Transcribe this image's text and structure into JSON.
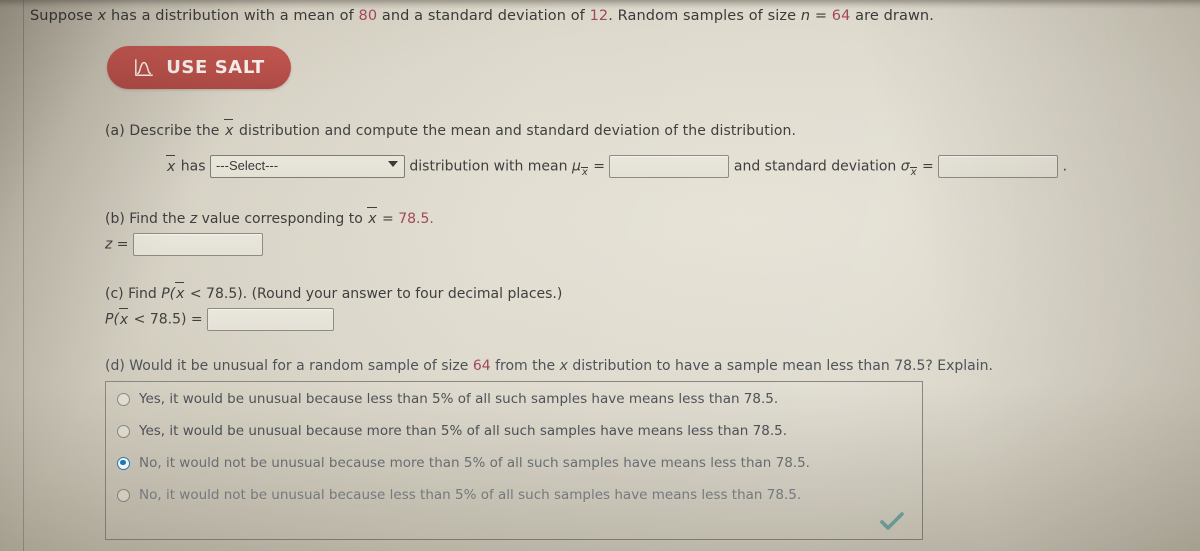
{
  "problem": {
    "statement_parts": [
      {
        "t": "Suppose ",
        "k": "plain"
      },
      {
        "t": "x",
        "k": "ital"
      },
      {
        "t": " has a distribution with a mean of ",
        "k": "plain"
      },
      {
        "t": "80",
        "k": "num"
      },
      {
        "t": " and a standard deviation of ",
        "k": "plain"
      },
      {
        "t": "12",
        "k": "num"
      },
      {
        "t": ". Random samples of size ",
        "k": "plain"
      },
      {
        "t": "n",
        "k": "ital"
      },
      {
        "t": " = ",
        "k": "plain"
      },
      {
        "t": "64",
        "k": "num"
      },
      {
        "t": " are drawn.",
        "k": "plain"
      }
    ],
    "mean": "80",
    "std_dev": "12",
    "sample_size": "64",
    "x_bar_value": "78.5"
  },
  "salt_button": {
    "label": "USE SALT",
    "icon": "normal-curve-icon",
    "color": "#b8504a"
  },
  "part_a": {
    "label": "(a) Describe the",
    "label_tail": "distribution and compute the mean and standard deviation of the distribution.",
    "has_prefix": "has",
    "select_value": "---Select---",
    "mean_prefix": "distribution with mean",
    "mean_symbol": "μ",
    "mean_value": "",
    "sd_prefix": "and standard deviation",
    "sd_symbol": "σ",
    "sd_value": "",
    "trailing": "."
  },
  "part_b": {
    "label_pre": "(b) Find the",
    "label_z": "z",
    "label_mid": "value corresponding to",
    "label_eq": "=",
    "label_val": "78.5.",
    "z_label": "z =",
    "z_value": ""
  },
  "part_c": {
    "label_pre": "(c) Find",
    "label_p": "P(",
    "label_lt": "< 78.5). (Round your answer to four decimal places.)",
    "answer_label_p": "P(",
    "answer_label_rest": "< 78.5) =",
    "answer_value": ""
  },
  "part_d": {
    "label_pre": "(d) Would it be unusual for a random sample of size",
    "label_n": "64",
    "label_mid": "from the",
    "label_x": "x",
    "label_tail": "distribution to have a sample mean less than 78.5? Explain.",
    "options": [
      {
        "label": "Yes, it would be unusual because less than 5% of all such samples have means less than 78.5.",
        "selected": false
      },
      {
        "label": "Yes, it would be unusual because more than 5% of all such samples have means less than 78.5.",
        "selected": false
      },
      {
        "label": "No, it would not be unusual because more than 5% of all such samples have means less than 78.5.",
        "selected": true
      },
      {
        "label": "No, it would not be unusual because less than 5% of all such samples have means less than 78.5.",
        "selected": false
      }
    ],
    "status_icon": "checkmark-icon",
    "status_color": "#6aa8a6"
  }
}
